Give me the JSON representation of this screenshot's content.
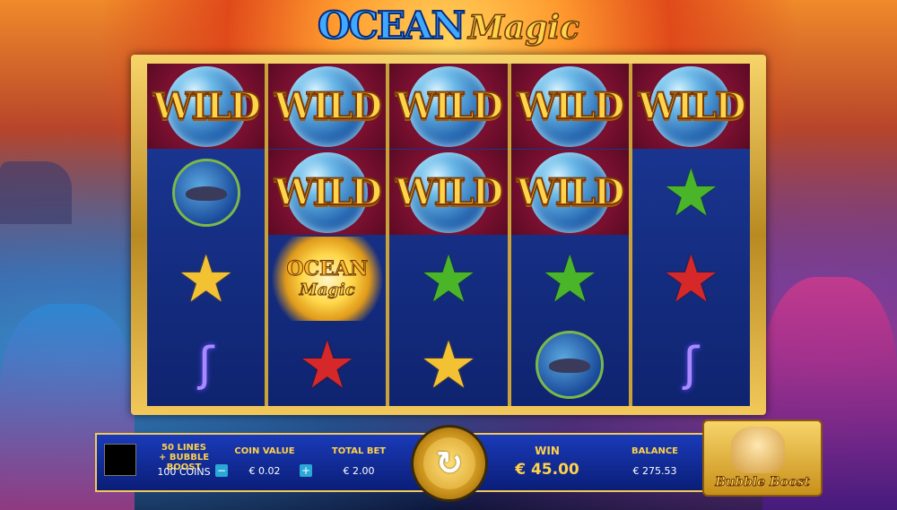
{
  "title": {
    "word1": "OCEAN",
    "word2": "Magic"
  },
  "reels": [
    [
      "wild",
      "shark",
      "gold-star",
      "seahorse"
    ],
    [
      "wild",
      "wild",
      "ocean-magic",
      "red-star"
    ],
    [
      "wild",
      "wild",
      "green-star",
      "gold-star"
    ],
    [
      "wild",
      "wild",
      "green-star",
      "shark"
    ],
    [
      "wild",
      "green-star",
      "red-star",
      "seahorse"
    ]
  ],
  "symbols": {
    "wild_label": "WILD",
    "ocean_magic_line1": "OCEAN",
    "ocean_magic_line2": "Magic"
  },
  "bottom_bar": {
    "lines_label_line1": "50 LINES",
    "lines_label_line2": "+ BUBBLE BOOST",
    "coins": "100 COINS",
    "coin_value_label": "COIN VALUE",
    "coin_value": "€ 0.02",
    "total_bet_label": "TOTAL BET",
    "total_bet": "€ 2.00",
    "win_label": "WIN",
    "win": "€ 45.00",
    "balance_label": "BALANCE",
    "balance": "€ 275.53",
    "minus": "−",
    "plus": "+"
  },
  "bubble_boost": {
    "label": "Bubble Boost"
  },
  "colors": {
    "gold": "#ffd24a",
    "bar_blue": "#1a3ab8",
    "reel_blue": "#1d3a9a",
    "wild_bg": "#7a1030"
  }
}
